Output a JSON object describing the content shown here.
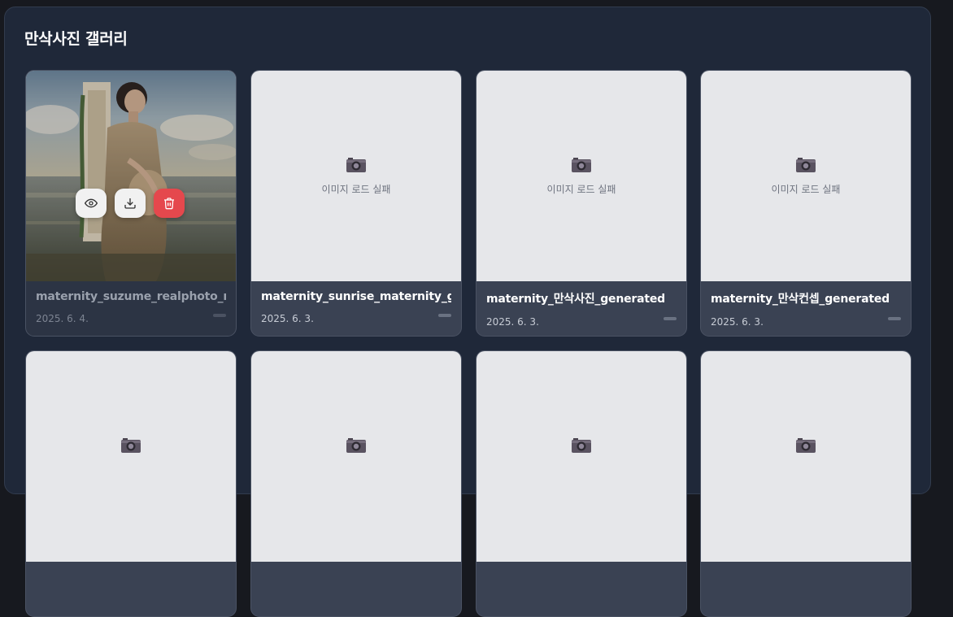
{
  "gallery": {
    "title": "만삭사진 갤러리",
    "placeholder_text": "이미지 로드 실패",
    "icons": {
      "placeholder": "camera-icon",
      "view": "eye-icon",
      "download": "download-icon",
      "delete": "trash-icon"
    },
    "colors": {
      "delete_button": "#e5484d",
      "panel": "#1f2839",
      "card": "#3a4253"
    },
    "items": [
      {
        "filename": "maternity_suzume_realphoto_mc",
        "date": "2025. 6. 4."
      },
      {
        "filename": "maternity_sunrise_maternity_gen",
        "date": "2025. 6. 3."
      },
      {
        "filename": "maternity_만삭사진_generated",
        "date": "2025. 6. 3."
      },
      {
        "filename": "maternity_만삭컨셉_generated",
        "date": "2025. 6. 3."
      },
      {
        "filename": "",
        "date": ""
      },
      {
        "filename": "",
        "date": ""
      },
      {
        "filename": "",
        "date": ""
      },
      {
        "filename": "",
        "date": ""
      }
    ]
  }
}
